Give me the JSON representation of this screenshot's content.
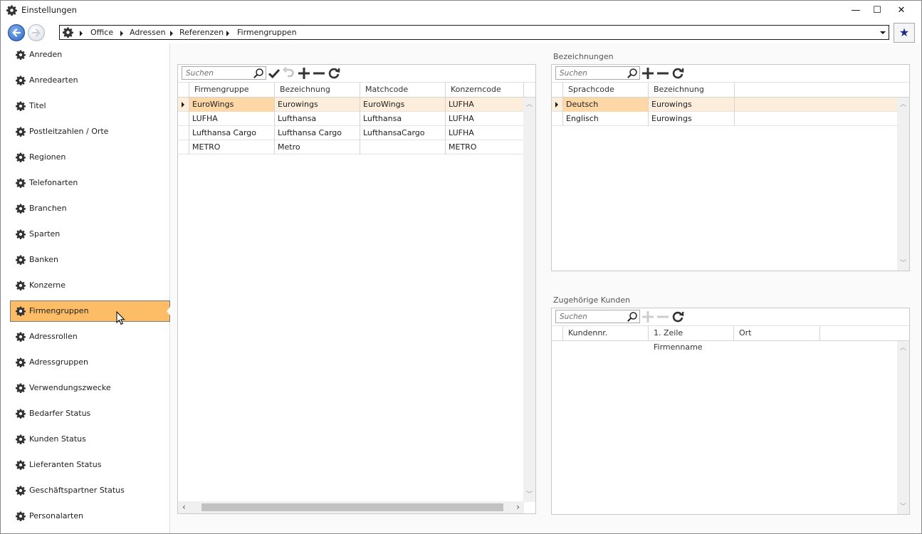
{
  "window": {
    "title": "Einstellungen",
    "controls": {
      "minimize": "—",
      "maximize": "☐",
      "close": "✕"
    }
  },
  "nav": {
    "breadcrumb": [
      "Office",
      "Adressen",
      "Referenzen",
      "Firmengruppen"
    ],
    "favorite_icon": "★"
  },
  "sidebar": {
    "items": [
      {
        "label": "Anreden"
      },
      {
        "label": "Anredearten"
      },
      {
        "label": "Titel"
      },
      {
        "label": "Postleitzahlen / Orte"
      },
      {
        "label": "Regionen"
      },
      {
        "label": "Telefonarten"
      },
      {
        "label": "Branchen"
      },
      {
        "label": "Sparten"
      },
      {
        "label": "Banken"
      },
      {
        "label": "Konzerne"
      },
      {
        "label": "Firmengruppen",
        "active": true
      },
      {
        "label": "Adressrollen"
      },
      {
        "label": "Adressgruppen"
      },
      {
        "label": "Verwendungszwecke"
      },
      {
        "label": "Bedarfer Status"
      },
      {
        "label": "Kunden Status"
      },
      {
        "label": "Lieferanten Status"
      },
      {
        "label": "Geschäftspartner Status"
      },
      {
        "label": "Personalarten"
      }
    ]
  },
  "firmengruppen_grid": {
    "search_placeholder": "Suchen",
    "columns": [
      "Firmengruppe",
      "Bezeichnung",
      "Matchcode",
      "Konzerncode"
    ],
    "rows": [
      [
        "EuroWings",
        "Eurowings",
        "EuroWings",
        "LUFHA"
      ],
      [
        "LUFHA",
        "Lufthansa",
        "Lufthansa",
        "LUFHA"
      ],
      [
        "Lufthansa Cargo",
        "Lufthansa Cargo",
        "LufthansaCargo",
        "LUFHA"
      ],
      [
        "METRO",
        "Metro",
        "",
        "METRO"
      ]
    ],
    "selected_row": 0
  },
  "bezeichnungen": {
    "title": "Bezeichnungen",
    "search_placeholder": "Suchen",
    "columns": [
      "Sprachcode",
      "Bezeichnung"
    ],
    "rows": [
      [
        "Deutsch",
        "Eurowings"
      ],
      [
        "Englisch",
        "Eurowings"
      ]
    ],
    "selected_row": 0
  },
  "kunden": {
    "title": "Zugehörige Kunden",
    "search_placeholder": "Suchen",
    "columns": [
      "Kundennr.",
      "1. Zeile Firmenname",
      "Ort"
    ],
    "rows": []
  },
  "colors": {
    "active_item": "#fdbd66",
    "selected_row": "#fdeedb",
    "selected_cell": "#fdd7a6"
  }
}
